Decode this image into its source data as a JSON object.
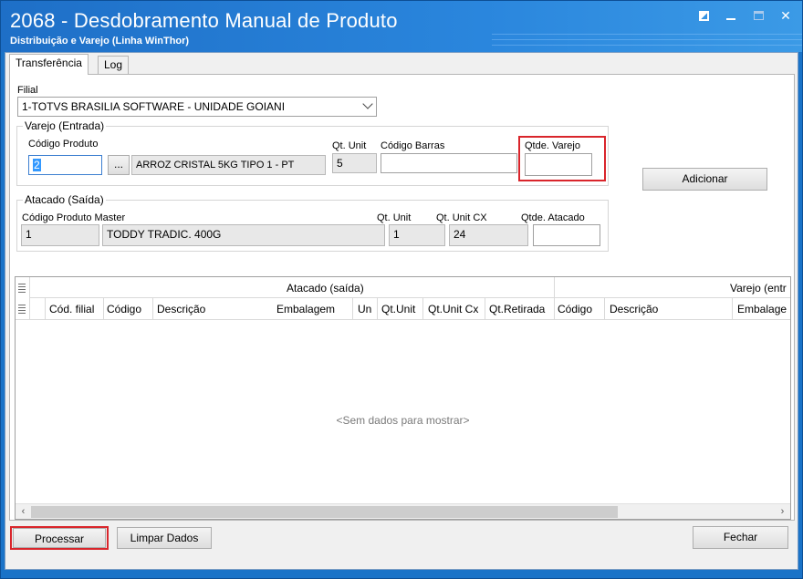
{
  "window": {
    "title": "2068 - Desdobramento Manual de Produto",
    "subtitle": "Distribuição e Varejo (Linha WinThor)",
    "controls": {
      "restore": "◪",
      "minimize": "_",
      "maximize": "□",
      "close": "✕"
    }
  },
  "tabs": [
    {
      "label": "Transferência",
      "active": true
    },
    {
      "label": "Log",
      "active": false
    }
  ],
  "filial": {
    "label": "Filial",
    "value": "1-TOTVS BRASILIA SOFTWARE - UNIDADE GOIANI"
  },
  "varejo": {
    "group_title": "Varejo (Entrada)",
    "codigo_produto_label": "Código Produto",
    "codigo_produto_value": "2",
    "browse_label": "...",
    "descricao_value": "ARROZ CRISTAL 5KG TIPO 1 - PT",
    "qt_unit_label": "Qt. Unit",
    "qt_unit_value": "5",
    "codigo_barras_label": "Código Barras",
    "codigo_barras_value": "",
    "qtde_varejo_label": "Qtde. Varejo",
    "qtde_varejo_value": ""
  },
  "atacado": {
    "group_title": "Atacado (Saída)",
    "codigo_master_label": "Código Produto Master",
    "codigo_master_value": "1",
    "descricao_value": "TODDY TRADIC. 400G",
    "qt_unit_label": "Qt. Unit",
    "qt_unit_value": "1",
    "qt_unit_cx_label": "Qt. Unit CX",
    "qt_unit_cx_value": "24",
    "qtde_atacado_label": "Qtde. Atacado",
    "qtde_atacado_value": ""
  },
  "adicionar_label": "Adicionar",
  "grid": {
    "band_atacado": "Atacado (saída)",
    "band_varejo": "Varejo (entr",
    "columns": [
      "Cód. filial",
      "Código",
      "Descrição",
      "Embalagem",
      "Un",
      "Qt.Unit",
      "Qt.Unit Cx",
      "Qt.Retirada",
      "Código",
      "Descrição",
      "Embalage"
    ],
    "empty_text": "<Sem dados para mostrar>",
    "scroll_left": "‹",
    "scroll_right": "›"
  },
  "footer": {
    "processar_label": "Processar",
    "limpar_label": "Limpar Dados",
    "fechar_label": "Fechar"
  },
  "colors": {
    "titlebar": "#1e6fc7",
    "highlight": "#d9252b"
  }
}
